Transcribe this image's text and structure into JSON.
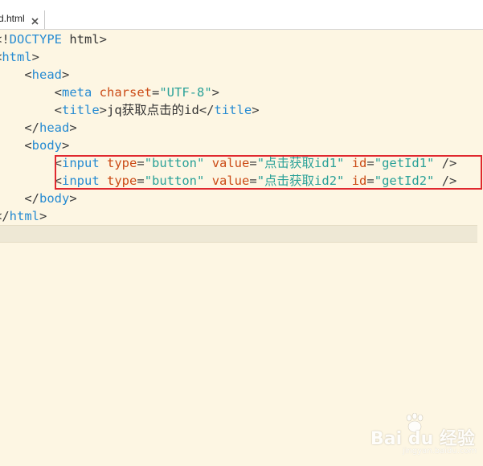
{
  "tab": {
    "label": "d.html",
    "close_icon": "close-icon"
  },
  "code_lines": [
    {
      "indent": "",
      "tokens": [
        {
          "t": "<!",
          "c": "punc"
        },
        {
          "t": "DOCTYPE",
          "c": "tag"
        },
        {
          "t": " html",
          "c": "txt"
        },
        {
          "t": ">",
          "c": "punc"
        }
      ]
    },
    {
      "indent": "",
      "tokens": [
        {
          "t": "<",
          "c": "punc"
        },
        {
          "t": "html",
          "c": "tag"
        },
        {
          "t": ">",
          "c": "punc"
        }
      ]
    },
    {
      "indent": "    ",
      "tokens": [
        {
          "t": "<",
          "c": "punc"
        },
        {
          "t": "head",
          "c": "tag"
        },
        {
          "t": ">",
          "c": "punc"
        }
      ]
    },
    {
      "indent": "        ",
      "tokens": [
        {
          "t": "<",
          "c": "punc"
        },
        {
          "t": "meta",
          "c": "tag"
        },
        {
          "t": " ",
          "c": "txt"
        },
        {
          "t": "charset",
          "c": "attr"
        },
        {
          "t": "=",
          "c": "punc"
        },
        {
          "t": "\"UTF-8\"",
          "c": "str"
        },
        {
          "t": ">",
          "c": "punc"
        }
      ]
    },
    {
      "indent": "        ",
      "tokens": [
        {
          "t": "<",
          "c": "punc"
        },
        {
          "t": "title",
          "c": "tag"
        },
        {
          "t": ">",
          "c": "punc"
        },
        {
          "t": "jq获取点击的id",
          "c": "txt"
        },
        {
          "t": "</",
          "c": "punc"
        },
        {
          "t": "title",
          "c": "tag"
        },
        {
          "t": ">",
          "c": "punc"
        }
      ]
    },
    {
      "indent": "    ",
      "tokens": [
        {
          "t": "</",
          "c": "punc"
        },
        {
          "t": "head",
          "c": "tag"
        },
        {
          "t": ">",
          "c": "punc"
        }
      ]
    },
    {
      "indent": "    ",
      "tokens": [
        {
          "t": "<",
          "c": "punc"
        },
        {
          "t": "body",
          "c": "tag"
        },
        {
          "t": ">",
          "c": "punc"
        }
      ]
    },
    {
      "indent": "        ",
      "tokens": [
        {
          "t": "<",
          "c": "punc"
        },
        {
          "t": "input",
          "c": "tag"
        },
        {
          "t": " ",
          "c": "txt"
        },
        {
          "t": "type",
          "c": "attr"
        },
        {
          "t": "=",
          "c": "punc"
        },
        {
          "t": "\"button\"",
          "c": "str"
        },
        {
          "t": " ",
          "c": "txt"
        },
        {
          "t": "value",
          "c": "attr"
        },
        {
          "t": "=",
          "c": "punc"
        },
        {
          "t": "\"点击获取id1\"",
          "c": "str"
        },
        {
          "t": " ",
          "c": "txt"
        },
        {
          "t": "id",
          "c": "attr"
        },
        {
          "t": "=",
          "c": "punc"
        },
        {
          "t": "\"getId1\"",
          "c": "str"
        },
        {
          "t": " />",
          "c": "punc"
        }
      ]
    },
    {
      "indent": "        ",
      "tokens": [
        {
          "t": "<",
          "c": "punc"
        },
        {
          "t": "input",
          "c": "tag"
        },
        {
          "t": " ",
          "c": "txt"
        },
        {
          "t": "type",
          "c": "attr"
        },
        {
          "t": "=",
          "c": "punc"
        },
        {
          "t": "\"button\"",
          "c": "str"
        },
        {
          "t": " ",
          "c": "txt"
        },
        {
          "t": "value",
          "c": "attr"
        },
        {
          "t": "=",
          "c": "punc"
        },
        {
          "t": "\"点击获取id2\"",
          "c": "str"
        },
        {
          "t": " ",
          "c": "txt"
        },
        {
          "t": "id",
          "c": "attr"
        },
        {
          "t": "=",
          "c": "punc"
        },
        {
          "t": "\"getId2\"",
          "c": "str"
        },
        {
          "t": " />",
          "c": "punc"
        }
      ]
    },
    {
      "indent": "    ",
      "tokens": [
        {
          "t": "</",
          "c": "punc"
        },
        {
          "t": "body",
          "c": "tag"
        },
        {
          "t": ">",
          "c": "punc"
        }
      ]
    },
    {
      "indent": "",
      "tokens": [
        {
          "t": "</",
          "c": "punc"
        },
        {
          "t": "html",
          "c": "tag"
        },
        {
          "t": ">",
          "c": "punc"
        }
      ]
    },
    {
      "indent": "",
      "tokens": [],
      "current": true
    }
  ],
  "highlight": {
    "color": "#e0282f"
  },
  "watermark": {
    "text": "Bai du 经验",
    "sub": "jingyan.baidu.com"
  },
  "colors": {
    "background": "#fdf6e3",
    "current_line": "#eee8d5",
    "tag": "#268bd2",
    "attribute": "#cb4b16",
    "string": "#2aa198"
  }
}
